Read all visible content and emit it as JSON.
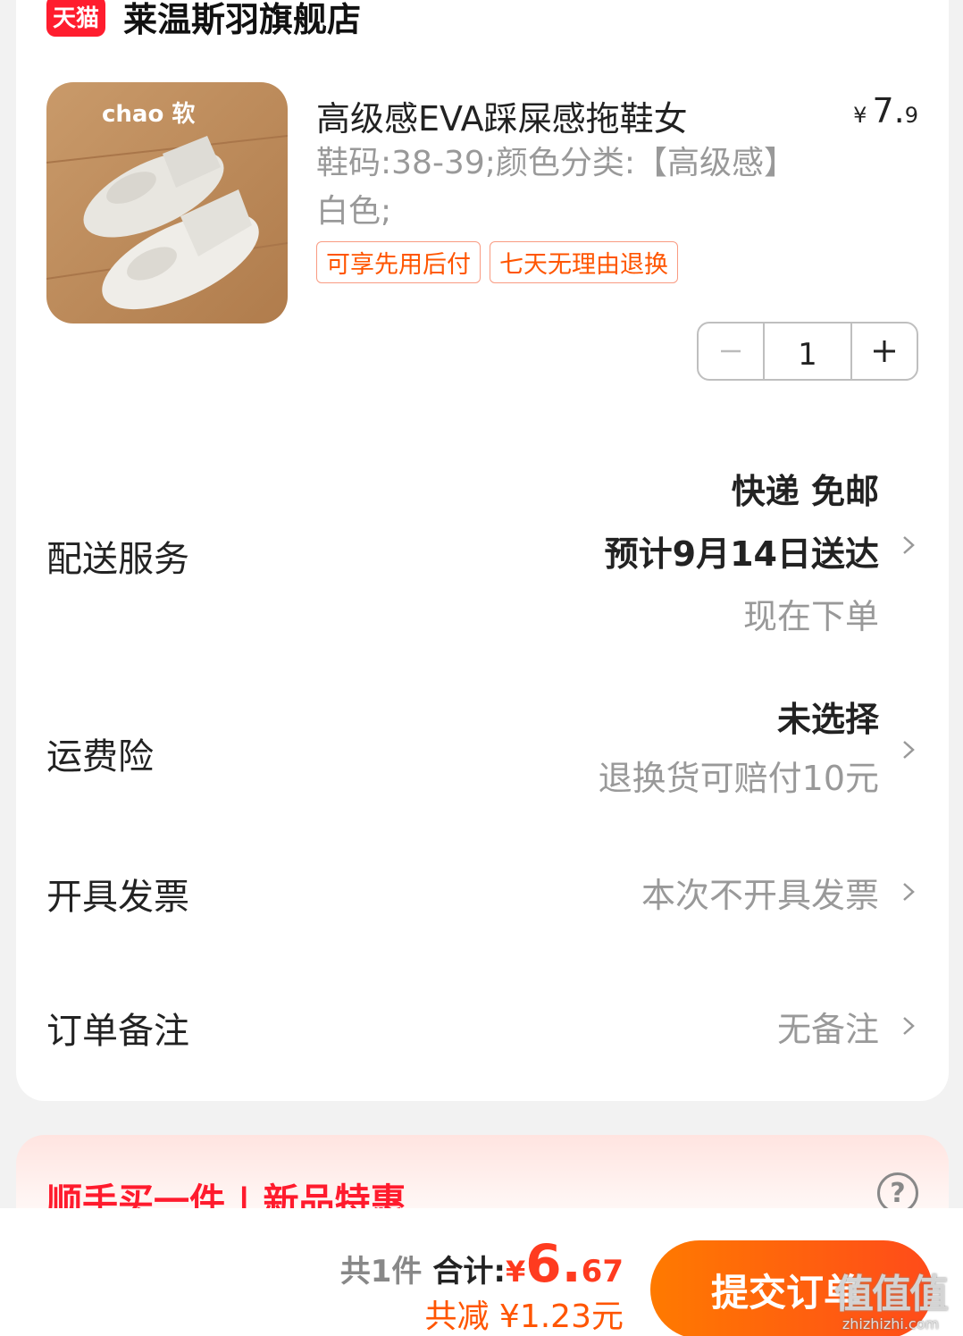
{
  "store": {
    "badge": "天猫",
    "name": "莱温斯羽旗舰店"
  },
  "product": {
    "image_caption": "chao 软",
    "title": "高级感EVA踩屎感拖鞋女",
    "price_symbol": "¥",
    "price_int": "7.",
    "price_dec": "9",
    "spec": "鞋码:38-39;颜色分类:【高级感】白色;",
    "tags": [
      "可享先用后付",
      "七天无理由退换"
    ],
    "quantity": "1"
  },
  "delivery": {
    "label": "配送服务",
    "method": "快递 免邮",
    "eta": "预计9月14日送达",
    "note": "现在下单"
  },
  "insurance": {
    "label": "运费险",
    "status": "未选择",
    "note": "退换货可赔付10元"
  },
  "invoice": {
    "label": "开具发票",
    "value": "本次不开具发票"
  },
  "remark": {
    "label": "订单备注",
    "value": "无备注"
  },
  "promo": {
    "title": "顺手买一件 | 新品特惠",
    "help": "?"
  },
  "footer": {
    "count": "共1件",
    "sum_label": "合计:",
    "sum_yen": "¥",
    "sum_int": "6.",
    "sum_dec": "67",
    "discount": "共减 ¥1.23元",
    "submit": "提交订单"
  },
  "watermark": {
    "main": "值值值",
    "sub": "zhizhizhi.com"
  },
  "colors": {
    "accent": "#ff5500",
    "price_red": "#ff3b1f",
    "tmall_red": "#ff1d2e",
    "promo_red": "#ff1b2d"
  },
  "icons": [
    "minus-icon",
    "plus-icon",
    "chevron-right-icon",
    "question-circle-icon"
  ]
}
